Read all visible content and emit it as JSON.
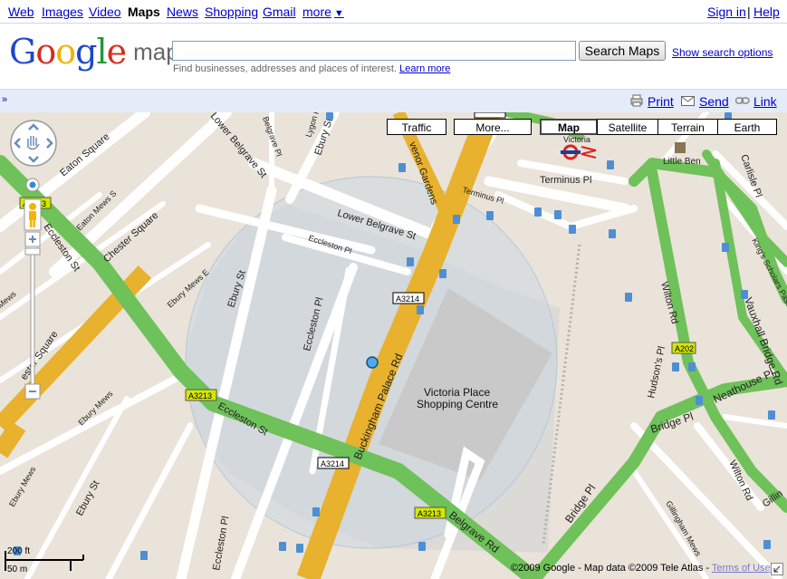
{
  "topnav": {
    "items": [
      "Web",
      "Images",
      "Video",
      "Maps",
      "News",
      "Shopping",
      "Gmail",
      "more"
    ],
    "current": "Maps",
    "sign_in": "Sign in",
    "help": "Help",
    "separator": "|",
    "more_arrow": "▼"
  },
  "logo": {
    "google": "Google",
    "maps": "maps"
  },
  "search": {
    "value": "",
    "button": "Search Maps",
    "show_options": "Show search options",
    "hint": "Find businesses, addresses and places of interest.",
    "learn_more": "Learn more"
  },
  "actions": {
    "print": "Print",
    "send": "Send",
    "link": "Link",
    "collapse": "»"
  },
  "map_types": {
    "traffic": "Traffic",
    "more": "More...",
    "map": "Map",
    "satellite": "Satellite",
    "terrain": "Terrain",
    "earth": "Earth",
    "selected": "Map"
  },
  "map_labels": {
    "eaton_square": "Eaton Square",
    "eaton_mews_s": "Eaton Mews S",
    "chester_square": "Chester Square",
    "chester_square_2": "ester Square",
    "eccleston_st_1": "Eccleston St",
    "eccleston_st_2": "Eccleston St",
    "ebury_mews_e": "Ebury Mews E",
    "ebury_mews_1": "Ebury Mews",
    "ebury_mews_2": "Ebury Mews",
    "ebury_st_1": "Ebury St",
    "ebury_st_2": "Ebury St",
    "ebury_st_3": "Ebury St",
    "lower_belgrave_st_1": "Lower Belgrave St",
    "lower_belgrave_st_2": "Lower Belgrave St",
    "eccleston_pl_1": "Eccleston Pl",
    "eccleston_pl_2": "Eccleston Pl",
    "eccleston_pl_3": "Eccleston Pl",
    "buckingham_palace_rd": "Buckingham Palace Rd",
    "grosvenor_gardens": "venor Gardens",
    "terminus_pl_1": "Terminus Pl",
    "terminus_pl_2": "Terminus Pl",
    "victoria": "Victoria",
    "little_ben": "Little Ben",
    "carlisle_pl": "Carlisle Pl",
    "kings_scholars": "King's Scholars Pass",
    "wilton_rd_1": "Wilton Rd",
    "wilton_rd_2": "Wilton Rd",
    "vauxhall_bridge_rd": "Vauxhall Bridge Rd",
    "neathouse_pl": "Neathouse Pl",
    "hudsons_pl": "Hudson's Pl",
    "bridge_pl_1": "Bridge Pl",
    "bridge_pl_2": "Bridge Pl",
    "belgrave_rd": "Belgrave Rd",
    "gillingham_mews": "Gillingham Mews",
    "gillingham": "Gillin",
    "victoria_place_1": "Victoria Place",
    "victoria_place_2": "Shopping Centre",
    "lygon_pl": "Lygon Pl",
    "belgrave_pl": "Belgrave Pl",
    "ebury_mews_s": "Ebury Mews S",
    "s_mews": "s Mews",
    "a3214_1": "A3214",
    "a3214_2": "A3214",
    "a3214_3": "A3214",
    "a3213_1": "A3213",
    "a3213_2": "A3213",
    "a3213_3": "A3213",
    "a202": "A202"
  },
  "scale": {
    "ft": "200 ft",
    "m": "50 m"
  },
  "copyright": {
    "text": "©2009 Google - Map data ©2009 Tele Atlas -",
    "terms": "Terms of Use"
  }
}
